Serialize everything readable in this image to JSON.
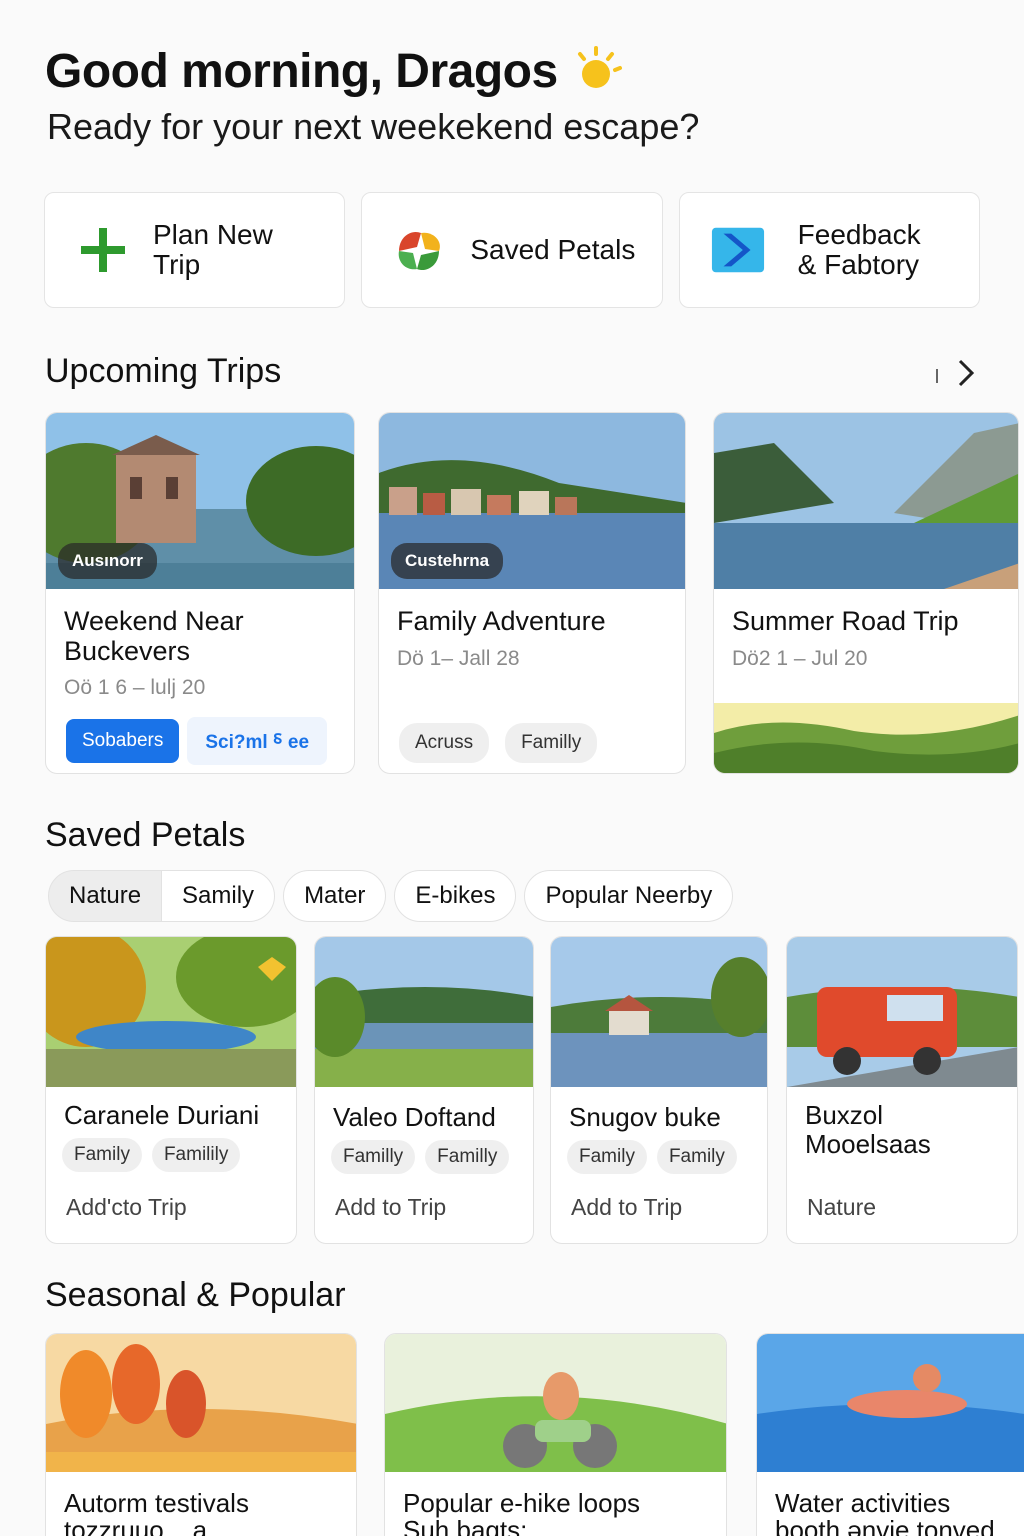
{
  "header": {
    "greeting": "Good morning, Dragos",
    "subtitle": "Ready for your next weekekend escape?"
  },
  "actions": [
    {
      "label": "Plan New Trip",
      "icon": "plus-icon"
    },
    {
      "label": "Saved Petals",
      "icon": "petals-logo-icon"
    },
    {
      "label_line1": "Feedback",
      "label_line2": "& Fabtory",
      "icon": "feedback-chevron-icon"
    }
  ],
  "upcoming": {
    "title": "Upcoming Trips",
    "trips": [
      {
        "tag": "Ausınorr",
        "title_line1": "Weekend Near",
        "title_line2": "Buckevers",
        "dates": "Oö 1 6 – lulj 20",
        "primary_button": "Sobabers",
        "link_button": "Sci?ml ⸹ ee"
      },
      {
        "tag": "Custehrna",
        "title": "Family Adventure",
        "dates": "Dö 1– Jall 28",
        "chips": [
          "Acruss",
          "Familly"
        ]
      },
      {
        "title": "Summer Road Trip",
        "dates": "Dö2 1 – Jul 20"
      }
    ]
  },
  "saved_petals": {
    "title": "Saved Petals",
    "filters": [
      "Nature",
      "Samily",
      "Mater",
      "E-bikes",
      "Popular Neerby"
    ],
    "cards": [
      {
        "title": "Caranele Duriani",
        "chips": [
          "Family",
          "Familily"
        ],
        "action": "Add'cto Trip"
      },
      {
        "title": "Valeo Doftand",
        "chips": [
          "Familly",
          "Familly"
        ],
        "action": "Add to Trip"
      },
      {
        "title": "Snugov buke",
        "chips": [
          "Family",
          "Family"
        ],
        "action": "Add to Trip"
      },
      {
        "title_line1": "Buxzol",
        "title_line2": "Mooelsaas",
        "action": "Nature"
      }
    ]
  },
  "seasonal": {
    "title": "Seasonal & Popular",
    "cards": [
      {
        "title_line1": "Autorm testivals",
        "title_line2": "tozzruuo... a"
      },
      {
        "title_line1": "Popular e-hike loops",
        "title_line2": "Suh bagts:"
      },
      {
        "title_line1": "Water activities",
        "title_line2": "booth ənvie tonved"
      }
    ]
  },
  "colors": {
    "accent": "#1a73e8",
    "plus": "#2e9a2e",
    "sun": "#f6c21c"
  }
}
